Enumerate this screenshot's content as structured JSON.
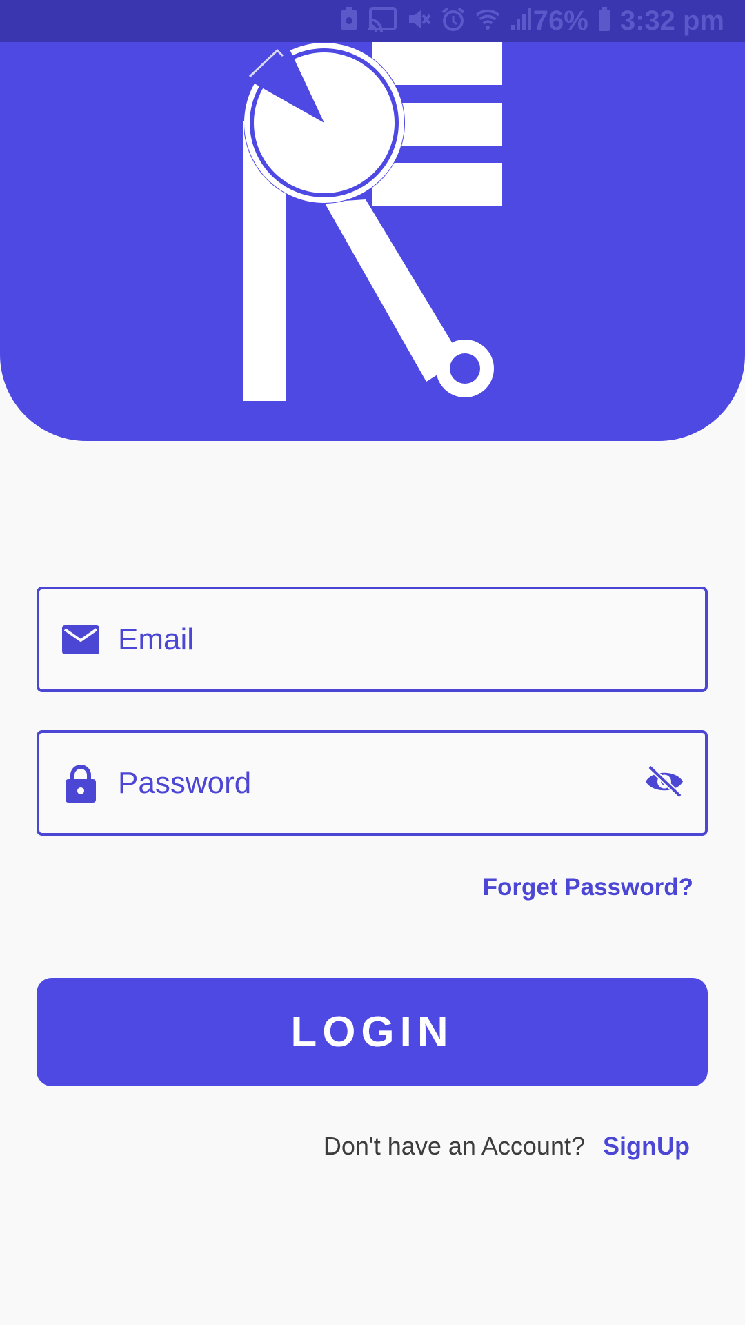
{
  "status_bar": {
    "battery_percent": "76%",
    "time": "3:32 pm",
    "icons": [
      "battery-saver-icon",
      "cast-icon",
      "mute-icon",
      "alarm-icon",
      "wifi-icon",
      "signal-icon",
      "battery-charging-icon"
    ]
  },
  "form": {
    "email_placeholder": "Email",
    "password_placeholder": "Password",
    "email_icon": "mail-icon",
    "password_icon": "lock-icon",
    "visibility_icon": "visibility-off-icon"
  },
  "forget_password_label": "Forget Password?",
  "login_label": "LOGIN",
  "signup_prompt": "Don't have an Account?",
  "signup_label": "SignUp",
  "colors": {
    "primary": "#4f49e3",
    "status_bar": "#3936b0",
    "background": "#f9f9f9"
  }
}
